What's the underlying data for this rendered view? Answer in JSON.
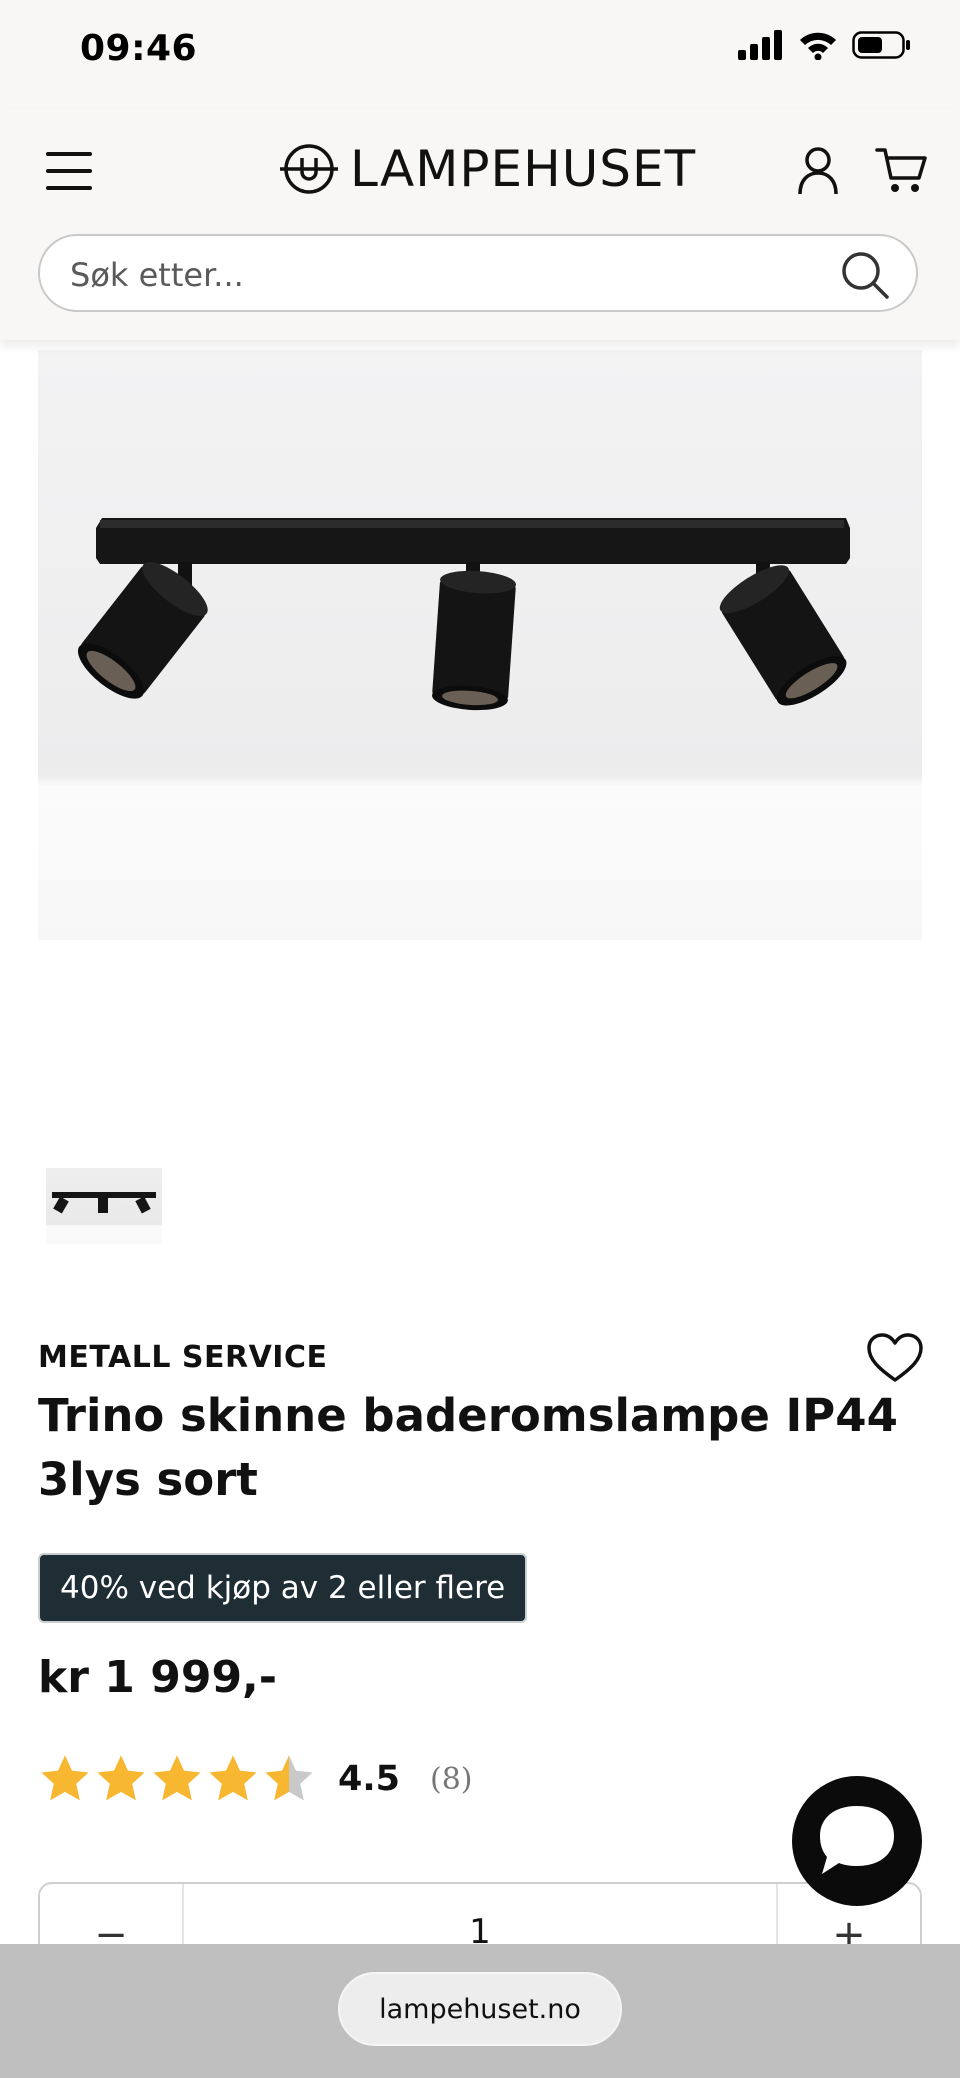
{
  "status_bar": {
    "time": "09:46"
  },
  "header": {
    "logo_text": "LAMPEHUSET",
    "search_placeholder": "Søk etter..."
  },
  "product": {
    "brand": "METALL SERVICE",
    "title": "Trino skinne baderomslampe IP44 3lys sort",
    "promo": "40% ved kjøp av 2 eller flere",
    "price": "kr 1 999,-",
    "rating": 4.5,
    "rating_display": "4.5",
    "review_count": "(8)",
    "quantity": "1"
  },
  "quantity_controls": {
    "minus": "−",
    "plus": "+"
  },
  "browser": {
    "url": "lampehuset.no"
  },
  "colors": {
    "header_bg": "#f8f7f5",
    "promo_bg": "#1f2e35",
    "star": "#f7b731",
    "star_empty": "#c9c9c9"
  }
}
